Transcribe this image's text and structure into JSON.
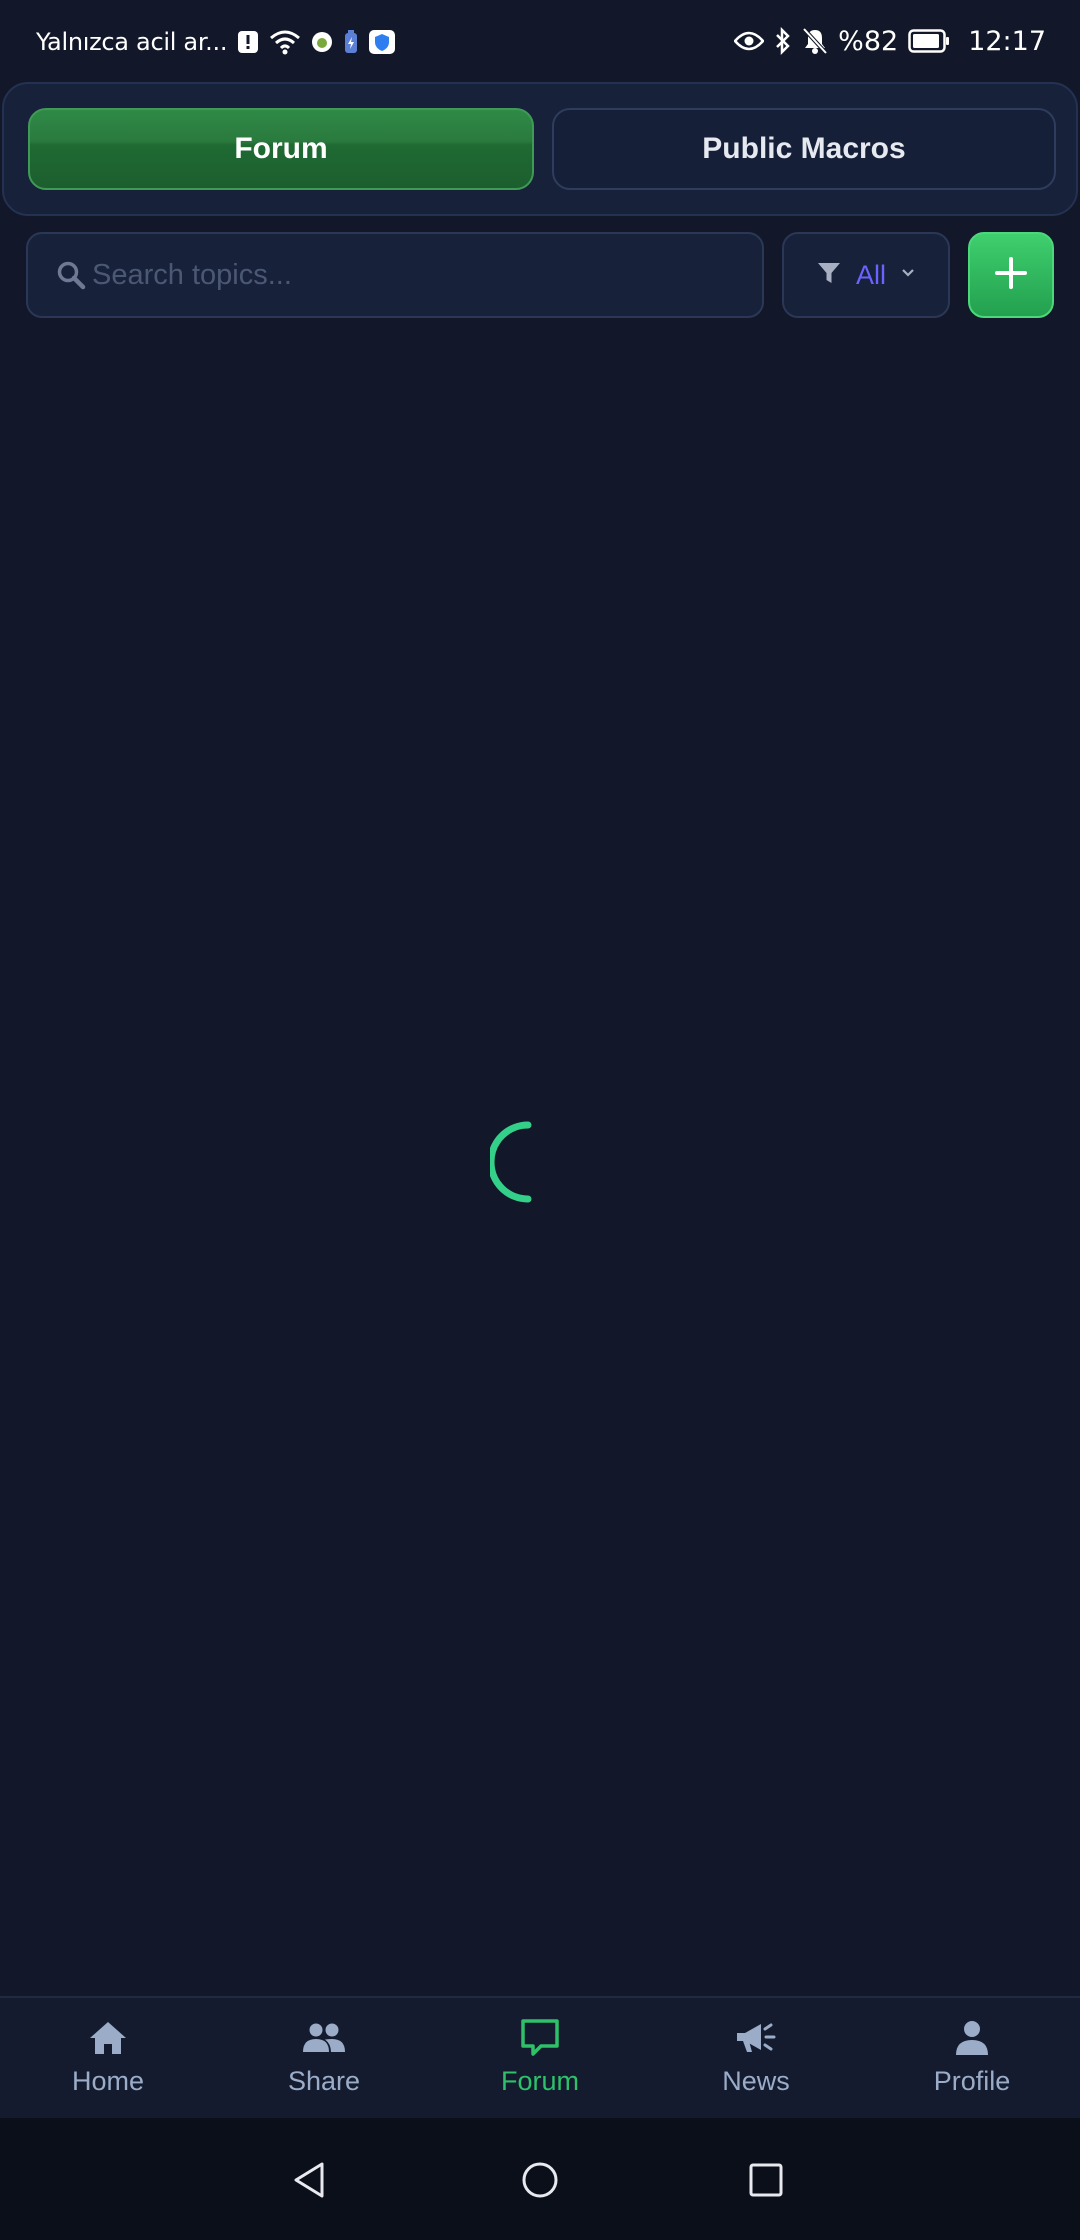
{
  "status_bar": {
    "carrier": "Yalnızca acil ar...",
    "battery_percent": "%82",
    "time": "12:17",
    "icons_left": [
      "alert-icon",
      "wifi-icon",
      "app-status-icon",
      "battery-saver-icon",
      "shield-icon"
    ],
    "icons_right": [
      "eye-icon",
      "bluetooth-icon",
      "bell-off-icon",
      "battery-icon"
    ]
  },
  "tabs": [
    {
      "label": "Forum",
      "active": true
    },
    {
      "label": "Public Macros",
      "active": false
    }
  ],
  "search": {
    "placeholder": "Search topics...",
    "value": ""
  },
  "filter": {
    "label": "All",
    "icon": "filter-icon"
  },
  "add_button": {
    "icon": "plus-icon"
  },
  "loading": {
    "icon": "spinner-icon"
  },
  "bottom_nav": [
    {
      "label": "Home",
      "icon": "home-icon",
      "active": false
    },
    {
      "label": "Share",
      "icon": "people-icon",
      "active": false
    },
    {
      "label": "Forum",
      "icon": "chat-icon",
      "active": true
    },
    {
      "label": "News",
      "icon": "megaphone-icon",
      "active": false
    },
    {
      "label": "Profile",
      "icon": "person-icon",
      "active": false
    }
  ],
  "colors": {
    "background": "#121829",
    "accent_green": "#2fc06a",
    "filter_text": "#6a63ff",
    "nav_inactive": "#9aacc8",
    "spinner": "#34d08a"
  }
}
